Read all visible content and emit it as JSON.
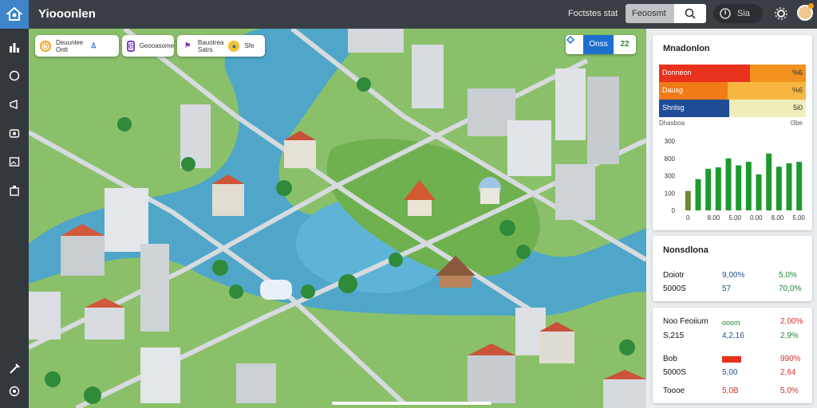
{
  "app": {
    "title": "Yiooonlen"
  },
  "topbar": {
    "link": "Foctstes stat",
    "search_value": "Feoosmt",
    "status_text": "Sia",
    "icons": [
      "logo-icon",
      "search-icon",
      "power-icon",
      "gear-icon",
      "avatar"
    ]
  },
  "sidebar": {
    "icons": [
      "bar-chart-icon",
      "circle-icon",
      "megaphone-icon",
      "camera-icon",
      "image-icon",
      "building-icon",
      "tools-icon",
      "settings-icon"
    ]
  },
  "map_chips": [
    {
      "line1": "Deuunlee",
      "line2": "Ontt",
      "icon": "clock-icon",
      "icon2": "person-icon"
    },
    {
      "line1": "Geooasome",
      "line2": "",
      "icon": "coin-icon"
    },
    {
      "line1": "Bauotrea",
      "line2": "Satrs",
      "icon": "flag-icon",
      "icon2": "water-icon",
      "extra": "Sfe"
    }
  ],
  "map_controls": {
    "label": "Onss",
    "value": "22"
  },
  "panel1": {
    "title": "Mnadonlon",
    "bars": [
      {
        "label": "Donneon",
        "value": "%6",
        "fill": 0.62,
        "color": "#e8321e",
        "rest": "#f2911e"
      },
      {
        "label": "Dausg",
        "value": "%6",
        "fill": 0.47,
        "color": "#f07b18",
        "rest": "#f7b640"
      },
      {
        "label": "Shnlsg",
        "value": "5i0",
        "fill": 0.48,
        "color": "#1e4d95",
        "rest": "#eeeebb"
      }
    ],
    "foot_left": "Dhasboa",
    "foot_right": "l3be"
  },
  "chart_data": {
    "type": "bar",
    "categories": [
      "0",
      "8.00",
      "5.00",
      "0.00",
      "8.00",
      "5.00"
    ],
    "series": [
      {
        "values": [
          28,
          45,
          60,
          62,
          75,
          65,
          70,
          52,
          82,
          63,
          68,
          70
        ]
      }
    ],
    "yticks": [
      "300",
      "800",
      "300",
      "100",
      "0"
    ],
    "ylim": [
      0,
      100
    ]
  },
  "panel2": {
    "title": "Nonsdlona",
    "rows": [
      {
        "label": "Doiotr",
        "v1": "9,00%",
        "v2": "5,0%"
      },
      {
        "label": "5000S",
        "v1": "57",
        "v2": "70,0%"
      }
    ]
  },
  "panel3": {
    "rows": [
      {
        "label": "Noo Feoiium",
        "v1": "ooom",
        "v2": "2,00%"
      },
      {
        "label": "S,215",
        "v1": "4,2,16",
        "v2": "2,9%"
      },
      {
        "label": "Bob",
        "v1": "",
        "v2": "990%"
      },
      {
        "label": "5000S",
        "v1": "5,00",
        "v2": "2,64"
      },
      {
        "label": "Toooe",
        "v1": "5,0B",
        "v2": "5,0%"
      }
    ]
  }
}
